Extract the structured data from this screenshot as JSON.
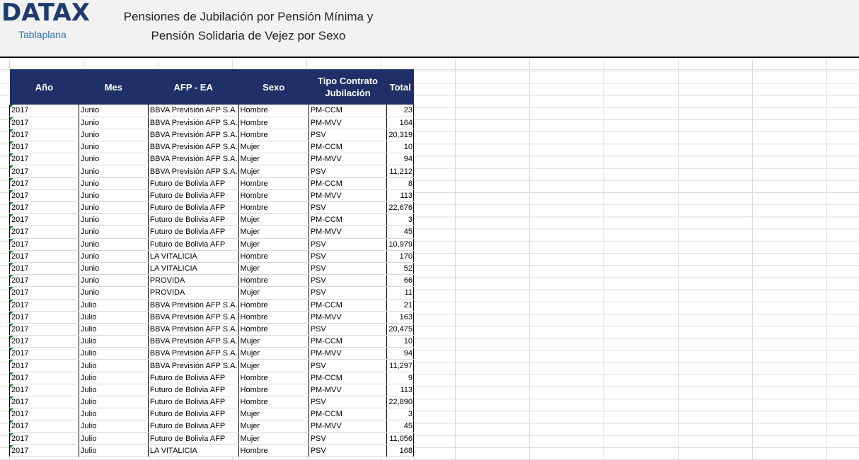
{
  "header": {
    "logo": "DATAX",
    "subtitle": "Tablaplana",
    "title_line1": "Pensiones de Jubilación por Pensión Mínima y",
    "title_line2": "Pensión Solidaria de Vejez por Sexo"
  },
  "table": {
    "columns": [
      "Año",
      "Mes",
      "AFP - EA",
      "Sexo",
      "Tipo Contrato Jubilación",
      "Total"
    ],
    "rows": [
      [
        "2017",
        "Junio",
        "BBVA Previsión AFP S.A.",
        "Hombre",
        "PM-CCM",
        "23"
      ],
      [
        "2017",
        "Junio",
        "BBVA Previsión AFP S.A.",
        "Hombre",
        "PM-MVV",
        "164"
      ],
      [
        "2017",
        "Junio",
        "BBVA Previsión AFP S.A.",
        "Hombre",
        "PSV",
        "20,319"
      ],
      [
        "2017",
        "Junio",
        "BBVA Previsión AFP S.A.",
        "Mujer",
        "PM-CCM",
        "10"
      ],
      [
        "2017",
        "Junio",
        "BBVA Previsión AFP S.A.",
        "Mujer",
        "PM-MVV",
        "94"
      ],
      [
        "2017",
        "Junio",
        "BBVA Previsión AFP S.A.",
        "Mujer",
        "PSV",
        "11,212"
      ],
      [
        "2017",
        "Junio",
        "Futuro de Bolivia AFP",
        "Hombre",
        "PM-CCM",
        "8"
      ],
      [
        "2017",
        "Junio",
        "Futuro de Bolivia AFP",
        "Hombre",
        "PM-MVV",
        "113"
      ],
      [
        "2017",
        "Junio",
        "Futuro de Bolivia AFP",
        "Hombre",
        "PSV",
        "22,676"
      ],
      [
        "2017",
        "Junio",
        "Futuro de Bolivia AFP",
        "Mujer",
        "PM-CCM",
        "3"
      ],
      [
        "2017",
        "Junio",
        "Futuro de Bolivia AFP",
        "Mujer",
        "PM-MVV",
        "45"
      ],
      [
        "2017",
        "Junio",
        "Futuro de Bolivia AFP",
        "Mujer",
        "PSV",
        "10,979"
      ],
      [
        "2017",
        "Junio",
        "LA VITALICIA",
        "Hombre",
        "PSV",
        "170"
      ],
      [
        "2017",
        "Junio",
        "LA VITALICIA",
        "Mujer",
        "PSV",
        "52"
      ],
      [
        "2017",
        "Junio",
        "PROVIDA",
        "Hombre",
        "PSV",
        "66"
      ],
      [
        "2017",
        "Junio",
        "PROVIDA",
        "Mujer",
        "PSV",
        "11"
      ],
      [
        "2017",
        "Julio",
        "BBVA Previsión AFP S.A.",
        "Hombre",
        "PM-CCM",
        "21"
      ],
      [
        "2017",
        "Julio",
        "BBVA Previsión AFP S.A.",
        "Hombre",
        "PM-MVV",
        "163"
      ],
      [
        "2017",
        "Julio",
        "BBVA Previsión AFP S.A.",
        "Hombre",
        "PSV",
        "20,475"
      ],
      [
        "2017",
        "Julio",
        "BBVA Previsión AFP S.A.",
        "Mujer",
        "PM-CCM",
        "10"
      ],
      [
        "2017",
        "Julio",
        "BBVA Previsión AFP S.A.",
        "Mujer",
        "PM-MVV",
        "94"
      ],
      [
        "2017",
        "Julio",
        "BBVA Previsión AFP S.A.",
        "Mujer",
        "PSV",
        "11,297"
      ],
      [
        "2017",
        "Julio",
        "Futuro de Bolivia AFP",
        "Hombre",
        "PM-CCM",
        "9"
      ],
      [
        "2017",
        "Julio",
        "Futuro de Bolivia AFP",
        "Hombre",
        "PM-MVV",
        "113"
      ],
      [
        "2017",
        "Julio",
        "Futuro de Bolivia AFP",
        "Hombre",
        "PSV",
        "22,890"
      ],
      [
        "2017",
        "Julio",
        "Futuro de Bolivia AFP",
        "Mujer",
        "PM-CCM",
        "3"
      ],
      [
        "2017",
        "Julio",
        "Futuro de Bolivia AFP",
        "Mujer",
        "PM-MVV",
        "45"
      ],
      [
        "2017",
        "Julio",
        "Futuro de Bolivia AFP",
        "Mujer",
        "PSV",
        "11,056"
      ],
      [
        "2017",
        "Julio",
        "LA VITALICIA",
        "Hombre",
        "PSV",
        "168"
      ]
    ]
  },
  "colors": {
    "header_fill": "#1f3068",
    "logo": "#1f3a6e",
    "subtitle": "#2e75b6",
    "cell_marker": "#1e8a3c"
  }
}
